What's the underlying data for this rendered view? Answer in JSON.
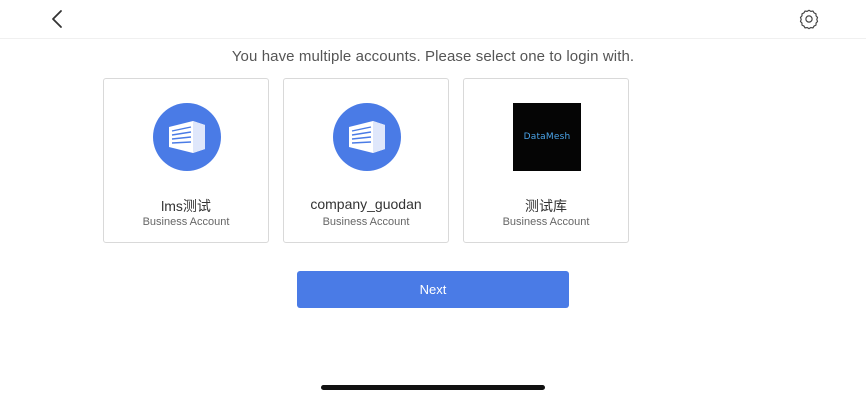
{
  "header": {
    "back_icon": "chevron-left-icon",
    "settings_icon": "gear-icon"
  },
  "prompt": "You have multiple accounts. Please select one to login with.",
  "accounts": [
    {
      "name": "lms测试",
      "type": "Business Account",
      "avatar": "building-icon",
      "avatar_color": "#4a7be6"
    },
    {
      "name": "company_guodan",
      "type": "Business Account",
      "avatar": "building-icon",
      "avatar_color": "#4a7be6"
    },
    {
      "name": "测试库",
      "type": "Business Account",
      "avatar": "datamesh-logo",
      "logo_text": "DataMesh",
      "avatar_color": "#050505"
    }
  ],
  "next_label": "Next",
  "colors": {
    "accent": "#4a7be6",
    "border": "#d9d9d9"
  }
}
